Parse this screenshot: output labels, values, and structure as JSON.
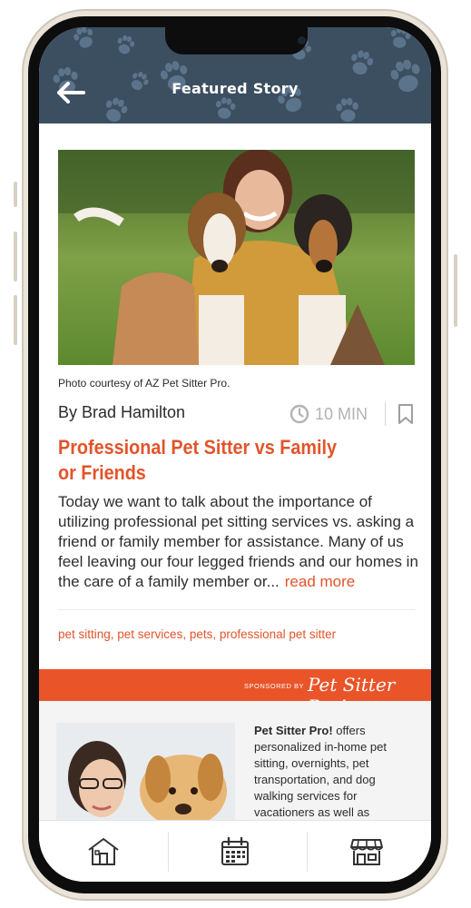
{
  "header": {
    "title": "Featured Story",
    "back_icon": "arrow-left-icon",
    "background_color": "#3c4f60"
  },
  "article": {
    "photo_caption": "Photo courtesy of AZ Pet Sitter Pro.",
    "author": "By Brad Hamilton",
    "read_time": "10 MIN",
    "clock_icon": "clock-icon",
    "bookmark_icon": "bookmark-icon",
    "headline": "Professional Pet Sitter vs Family or Friends",
    "excerpt": "Today we want to talk about the importance of utilizing professional pet sitting services vs. asking a friend or family member for assistance. Many of us feel leaving our four legged friends and our homes in the care of a family member or...",
    "read_more": "read more",
    "tags": "pet sitting, pet services, pets, professional pet sitter",
    "accent_color": "#e2542a"
  },
  "sponsor": {
    "label": "SPONSORED BY",
    "logo_text": "Pet Sitter Pro!",
    "bar_color": "#ea5429",
    "ad_name": "Pet Sitter Pro!",
    "ad_text": " offers personalized in-home pet sitting, overnights, pet transportation, and dog walking services for vacationers as well as"
  },
  "tabbar": {
    "tabs": [
      {
        "icon": "home-icon"
      },
      {
        "icon": "calendar-icon"
      },
      {
        "icon": "storefront-icon"
      }
    ]
  }
}
